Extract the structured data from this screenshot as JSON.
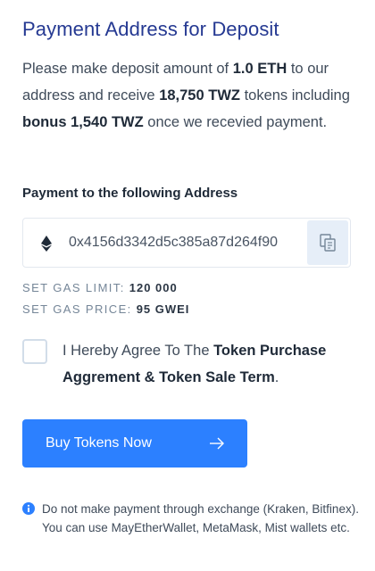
{
  "title": "Payment Address for Deposit",
  "intro": {
    "p1": "Please make deposit amount of ",
    "amount": "1.0 ETH",
    "p2": " to our address and receive ",
    "tokens": "18,750 TWZ",
    "p3": " tokens including ",
    "bonus": "bonus 1,540 TWZ",
    "p4": " once we recevied payment."
  },
  "address": {
    "label": "Payment to the following Address",
    "value": "0x4156d3342d5c385a87d264f90",
    "icon": "ethereum-icon",
    "copy_icon": "copy-icon"
  },
  "gas": {
    "limit_label": "SET GAS LIMIT: ",
    "limit_value": "120 000",
    "price_label": "SET GAS PRICE: ",
    "price_value": "95 GWEI"
  },
  "agreement": {
    "checked": false,
    "prefix": "I Hereby Agree To The ",
    "terms": "Token Purchase Aggrement & Token Sale Term",
    "suffix": "."
  },
  "buy_button": {
    "label": "Buy Tokens Now",
    "icon": "arrow-right-icon"
  },
  "note": {
    "icon": "info-icon",
    "text": "Do not make payment through exchange (Kraken, Bitfinex). You can use MayEtherWallet, MetaMask, Mist wallets etc."
  },
  "colors": {
    "title": "#253992",
    "button": "#2c80ff",
    "copy_bg": "#e6eef8",
    "info_icon": "#2c80ff"
  }
}
